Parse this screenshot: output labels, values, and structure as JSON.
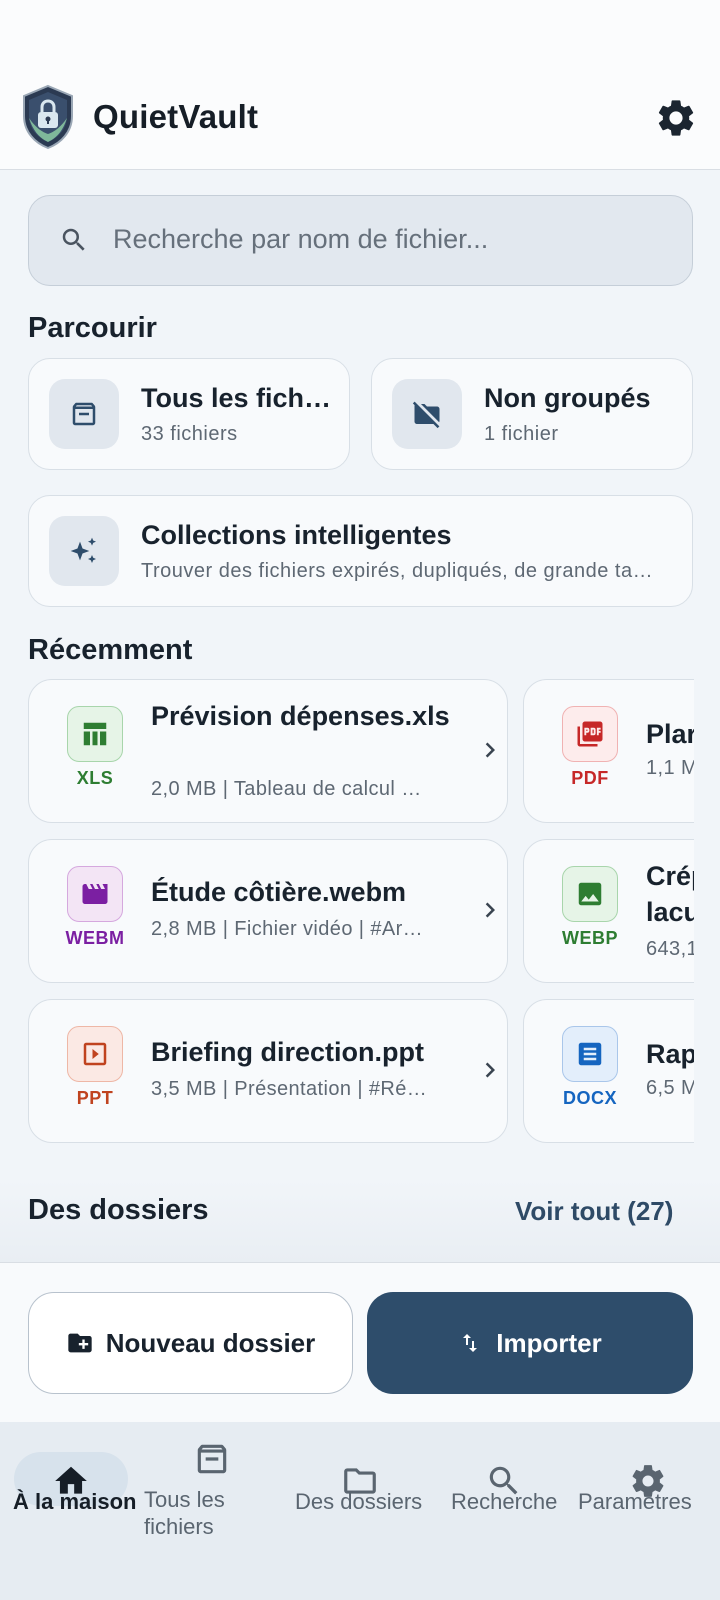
{
  "app": {
    "title": "QuietVault",
    "accent": "#2e4d6b"
  },
  "search": {
    "placeholder": "Recherche par nom de fichier..."
  },
  "browse": {
    "title": "Parcourir",
    "all_files": {
      "label": "Tous les fichi…",
      "count": "33 fichiers",
      "icon": "archive-icon"
    },
    "ungrouped": {
      "label": "Non groupés",
      "count": "1 fichier",
      "icon": "folder-off-icon"
    },
    "smart": {
      "label": "Collections intelligentes",
      "desc": "Trouver des fichiers expirés, dupliqués, de grande ta…",
      "icon": "sparkle-icon"
    }
  },
  "recent": {
    "title": "Récemment",
    "items": [
      {
        "name": "Prévision dépenses.xls",
        "meta": "2,0 MB | Tableau de calcul …",
        "ext": "XLS",
        "color": "#2e7d32"
      },
      {
        "name": "Plar",
        "meta": "1,1 M",
        "ext": "PDF",
        "color": "#c62828"
      },
      {
        "name": "Étude côtière.webm",
        "meta": "2,8 MB | Fichier vidéo | #Ar…",
        "ext": "WEBM",
        "color": "#7b1fa2"
      },
      {
        "name": "Crép lacu",
        "meta": "643,1",
        "ext": "WEBP",
        "color": "#2e7d32"
      },
      {
        "name": "Briefing direction.ppt",
        "meta": "3,5 MB | Présentation | #Ré…",
        "ext": "PPT",
        "color": "#c0431f"
      },
      {
        "name": "Rap",
        "meta": "6,5 M",
        "ext": "DOCX",
        "color": "#1565c0"
      }
    ]
  },
  "folders": {
    "title": "Des dossiers",
    "see_all": "Voir tout (27)"
  },
  "actions": {
    "new_folder": "Nouveau dossier",
    "import": "Importer"
  },
  "nav": {
    "home": "À la maison",
    "all_files": "Tous les fichiers",
    "folders": "Des dossiers",
    "search": "Recherche",
    "settings": "Paramètres"
  }
}
